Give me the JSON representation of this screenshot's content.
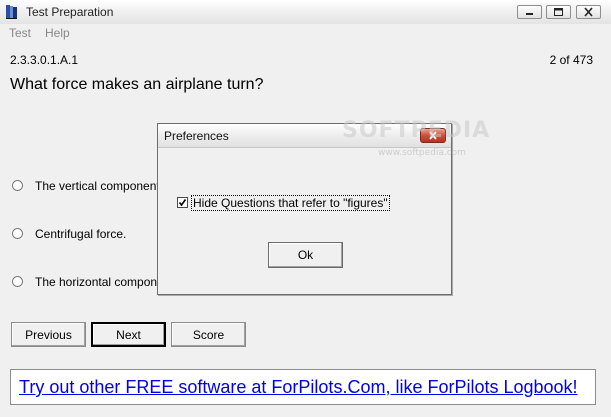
{
  "window": {
    "title": "Test Preparation",
    "icon": "book-icon"
  },
  "menu": {
    "items": [
      "Test",
      "Help"
    ]
  },
  "question": {
    "id": "2.3.3.0.1.A.1",
    "counter": "2 of 473",
    "text": "What force makes an airplane turn?",
    "options": [
      "The vertical component o",
      "Centrifugal force.",
      "The horizontal component"
    ]
  },
  "buttons": {
    "previous": "Previous",
    "next": "Next",
    "score": "Score"
  },
  "promo": {
    "text": "Try out other FREE software at ForPilots.Com, like ForPilots Logbook!"
  },
  "dialog": {
    "title": "Preferences",
    "checkbox_label": "Hide Questions that refer to \"figures\"",
    "checkbox_checked": true,
    "ok_label": "Ok"
  },
  "watermark": {
    "text": "SOFTPEDIA",
    "url": "www.softpedia.com"
  },
  "colors": {
    "link": "#0000ee",
    "close_button": "#c9503b",
    "window_bg": "#f0f0f0"
  }
}
